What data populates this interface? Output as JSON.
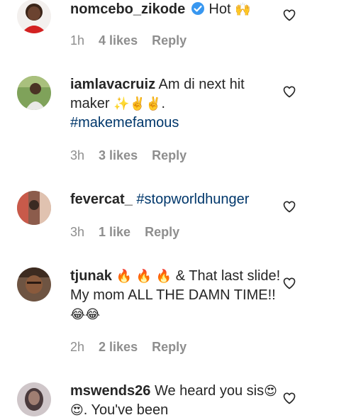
{
  "comments": [
    {
      "username": "nomcebo_zikode",
      "verified": true,
      "text": "Hot",
      "emoji": "🙌",
      "time": "1h",
      "likes": "4 likes",
      "reply": "Reply"
    },
    {
      "username": "iamlavacruiz",
      "text": "Am di next hit maker",
      "emoji": "✨✌️✌️.",
      "hashtag": "#makemefamous",
      "time": "3h",
      "likes": "3 likes",
      "reply": "Reply"
    },
    {
      "username": "fevercat_",
      "hashtag": "#stopworldhunger",
      "time": "3h",
      "likes": "1 like",
      "reply": "Reply"
    },
    {
      "username": "tjunak",
      "emoji": "🔥 🔥 🔥",
      "text": "& That last slide! My mom ALL THE DAMN TIME!!",
      "emoji2": "😂😂",
      "time": "2h",
      "likes": "2 likes",
      "reply": "Reply"
    },
    {
      "username": "mswends26",
      "text": "We heard you sis",
      "emoji": "😍😍",
      "text2": ". You've been"
    }
  ]
}
